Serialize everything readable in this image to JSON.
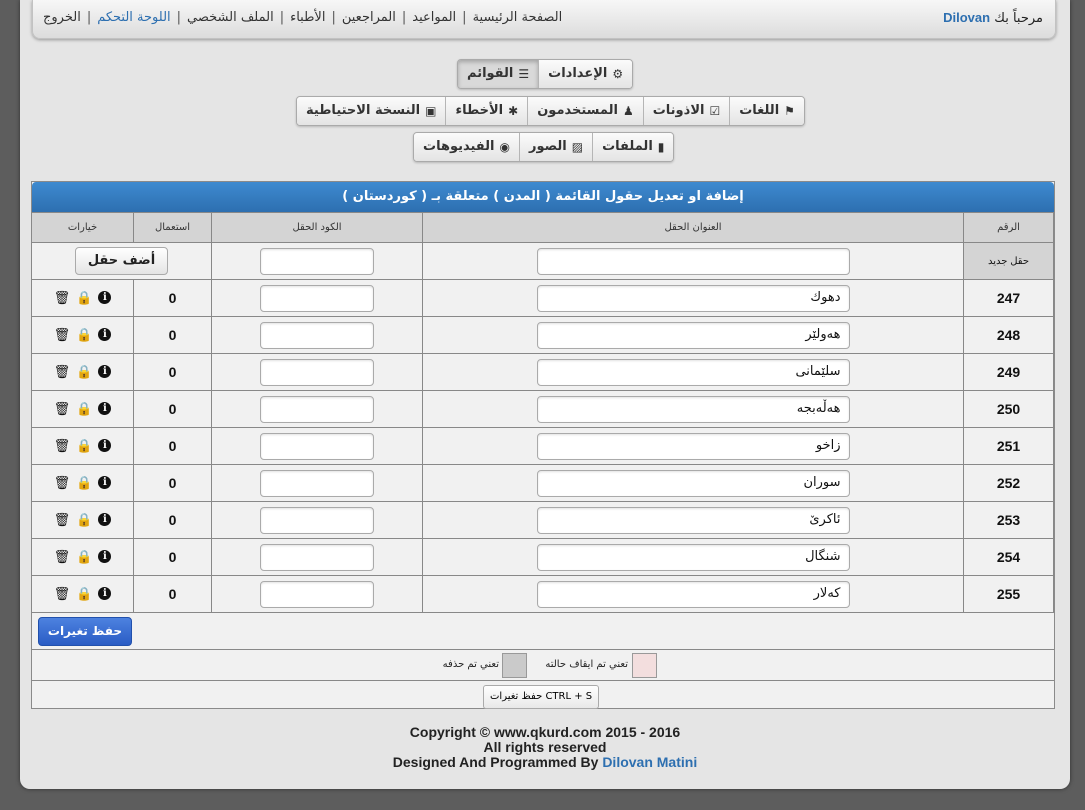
{
  "header": {
    "welcome": "مرحباً بك",
    "username": "Dilovan",
    "nav": [
      {
        "label": "الصفحة الرئيسية"
      },
      {
        "label": "المواعيد"
      },
      {
        "label": "المراجعين"
      },
      {
        "label": "الأطباء"
      },
      {
        "label": "الملف الشخصي"
      },
      {
        "label": "اللوحة التحكم",
        "active": true
      },
      {
        "label": "الخروج"
      }
    ]
  },
  "tabs_row1": [
    {
      "label": "الإعدادات",
      "icon": "gear-icon"
    },
    {
      "label": "القوائم",
      "icon": "list-icon",
      "active": true
    }
  ],
  "tabs_row2": [
    {
      "label": "اللغات",
      "icon": "language-icon"
    },
    {
      "label": "الاذونات",
      "icon": "check-square-icon"
    },
    {
      "label": "المستخدمون",
      "icon": "users-icon"
    },
    {
      "label": "الأخطاء",
      "icon": "bug-icon"
    },
    {
      "label": "النسخة الاحتياطية",
      "icon": "briefcase-icon"
    }
  ],
  "tabs_row3": [
    {
      "label": "الملفات",
      "icon": "file-icon"
    },
    {
      "label": "الصور",
      "icon": "picture-icon"
    },
    {
      "label": "الفيديوهات",
      "icon": "play-circle-icon"
    }
  ],
  "panel": {
    "title": "إضافة او تعديل حقول القائمة ( المدن ) متعلقة بـ ( كوردستان )",
    "columns": {
      "id": "الرقم",
      "title": "العنوان الحقل",
      "code": "الكود الحقل",
      "usage": "استعمال",
      "options": "خيارات"
    },
    "new_row": {
      "label": "حقل جديد",
      "title_value": "",
      "code_value": "",
      "add_button": "أضف حقل"
    },
    "rows": [
      {
        "id": "247",
        "title": "دهوك",
        "code": "",
        "usage": "0"
      },
      {
        "id": "248",
        "title": "هەولێر",
        "code": "",
        "usage": "0"
      },
      {
        "id": "249",
        "title": "سلێمانی",
        "code": "",
        "usage": "0"
      },
      {
        "id": "250",
        "title": "هەڵەبجە",
        "code": "",
        "usage": "0"
      },
      {
        "id": "251",
        "title": "زاخو",
        "code": "",
        "usage": "0"
      },
      {
        "id": "252",
        "title": "سوران",
        "code": "",
        "usage": "0"
      },
      {
        "id": "253",
        "title": "ئاکرێ",
        "code": "",
        "usage": "0"
      },
      {
        "id": "254",
        "title": "شنگال",
        "code": "",
        "usage": "0"
      },
      {
        "id": "255",
        "title": "کەلار",
        "code": "",
        "usage": "0"
      }
    ],
    "save_button": "حفظ تغيرات",
    "legend_suspended": "تعني تم ايقاف حالته",
    "legend_deleted": "تعني تم حذفه",
    "legend_suspended_color": "#f3dede",
    "legend_deleted_color": "#cacaca",
    "shortcut_hint": "CTRL + S حفظ تغيرات"
  },
  "footer": {
    "line1": "Copyright © www.qkurd.com 2015 - 2016",
    "line2": "All rights reserved",
    "line3_prefix": "Designed And Programmed By",
    "line3_name": "Dilovan Matini"
  }
}
